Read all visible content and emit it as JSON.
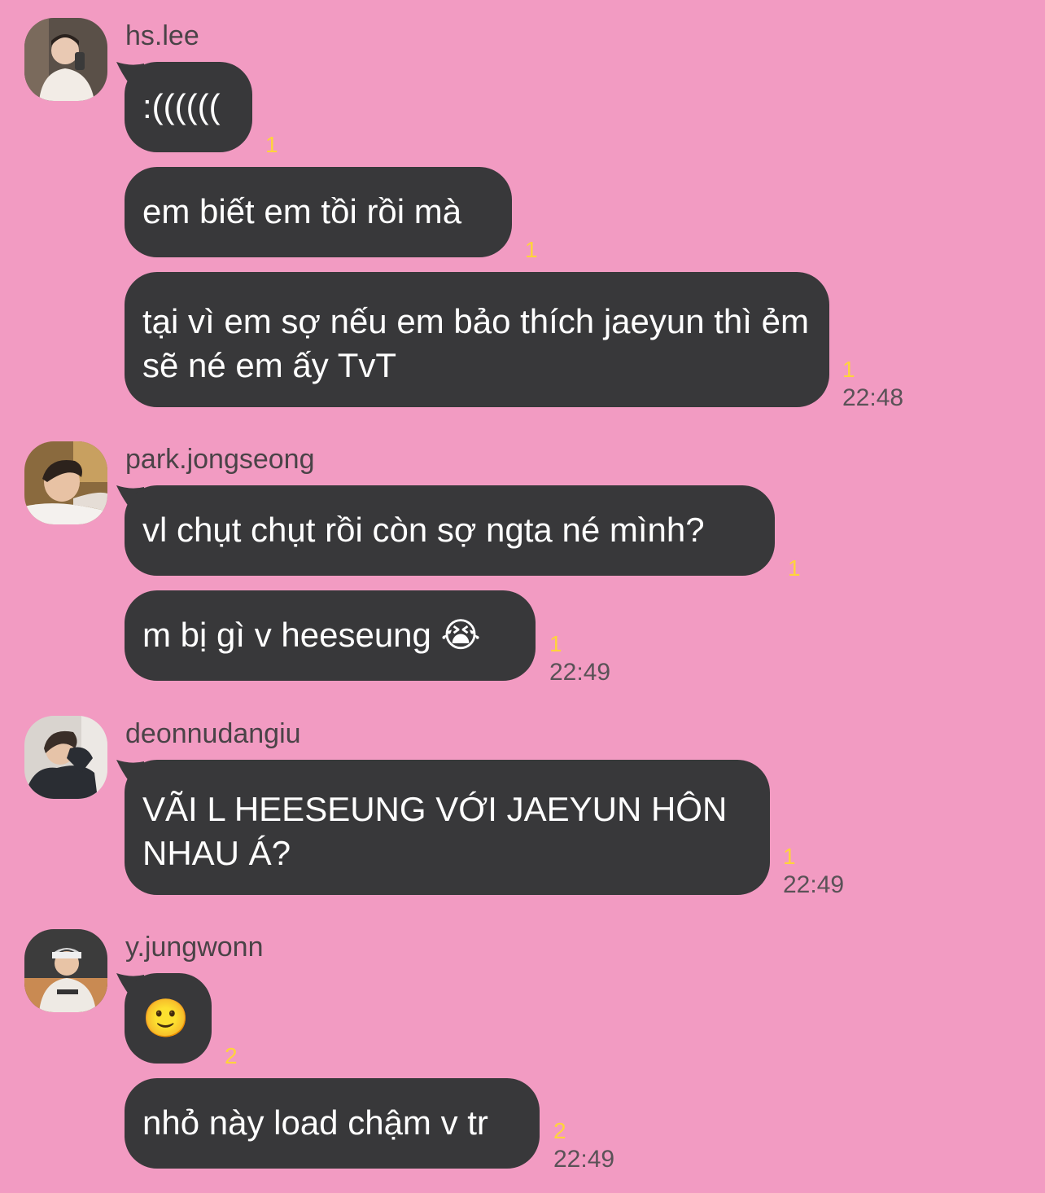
{
  "groups": [
    {
      "username": "hs.lee",
      "messages": [
        {
          "text": ":((((((",
          "unread": "1"
        },
        {
          "text": "em biết em tồi rồi mà",
          "unread": "1"
        },
        {
          "text": "tại vì em sợ nếu em bảo thích jaeyun thì ẻm sẽ né em ấy TvT",
          "unread": "1"
        }
      ],
      "time": "22:48"
    },
    {
      "username": "park.jongseong",
      "messages": [
        {
          "text": "vl chụt chụt rồi còn sợ ngta né mình?",
          "unread": "1"
        },
        {
          "text": "m bị gì v heeseung 😭",
          "unread": "1"
        }
      ],
      "time": "22:49"
    },
    {
      "username": "deonnudangiu",
      "messages": [
        {
          "text": "VÃI L HEESEUNG VỚI JAEYUN HÔN NHAU Á?",
          "unread": "1"
        }
      ],
      "time": "22:49"
    },
    {
      "username": "y.jungwonn",
      "messages": [
        {
          "text": "🙂",
          "unread": "2"
        },
        {
          "text": "nhỏ này load chậm v tr",
          "unread": "2"
        }
      ],
      "time": "22:49"
    }
  ],
  "colors": {
    "background": "#f29bc2",
    "bubble": "#38383a",
    "unread": "#ffd43b"
  }
}
